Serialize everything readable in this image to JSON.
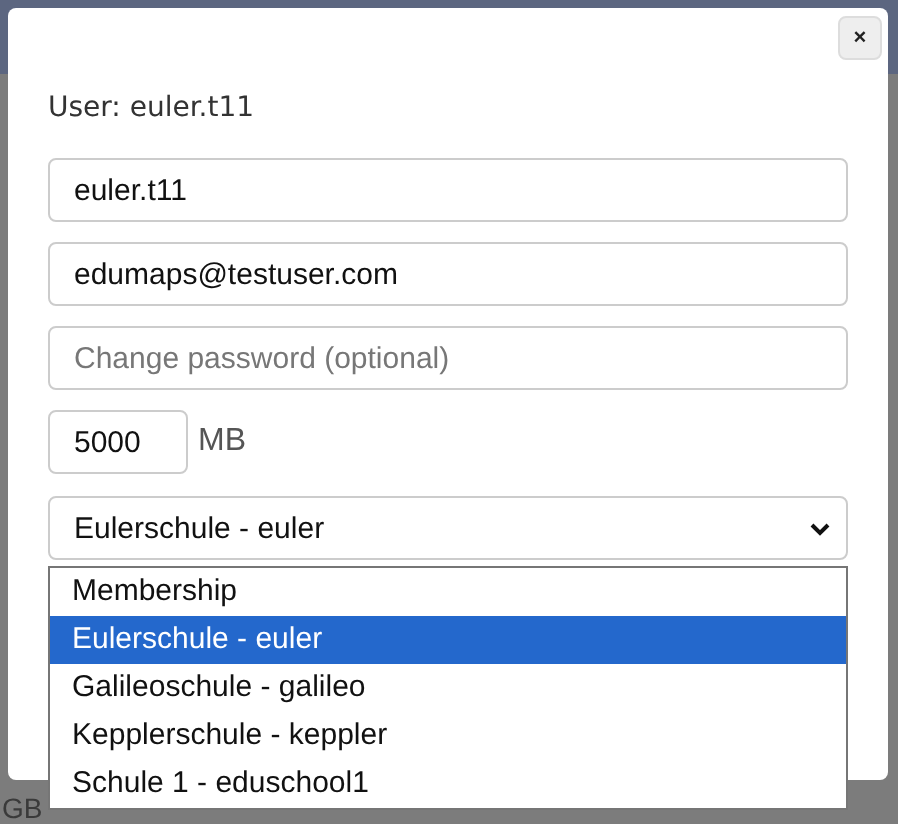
{
  "background": {
    "bottom_texts": [
      "GB"
    ]
  },
  "dialog": {
    "close": "×",
    "title": "User: euler.t11",
    "fields": [
      {
        "value": "euler.t11"
      },
      {
        "value": "edumaps@testuser.com"
      },
      {
        "placeholder": "Change password (optional)"
      }
    ],
    "quota": {
      "value": "5000",
      "unit": "MB"
    },
    "membership": {
      "value": "Eulerschule - euler",
      "expanded": true,
      "options": [
        {
          "label": "Membership",
          "selected": false
        },
        {
          "label": "Eulerschule - euler",
          "selected": true
        },
        {
          "label": "Galileoschule - galileo",
          "selected": false
        },
        {
          "label": "Kepplerschule - keppler",
          "selected": false
        },
        {
          "label": "Schule 1 - eduschool1",
          "selected": false
        }
      ]
    }
  }
}
